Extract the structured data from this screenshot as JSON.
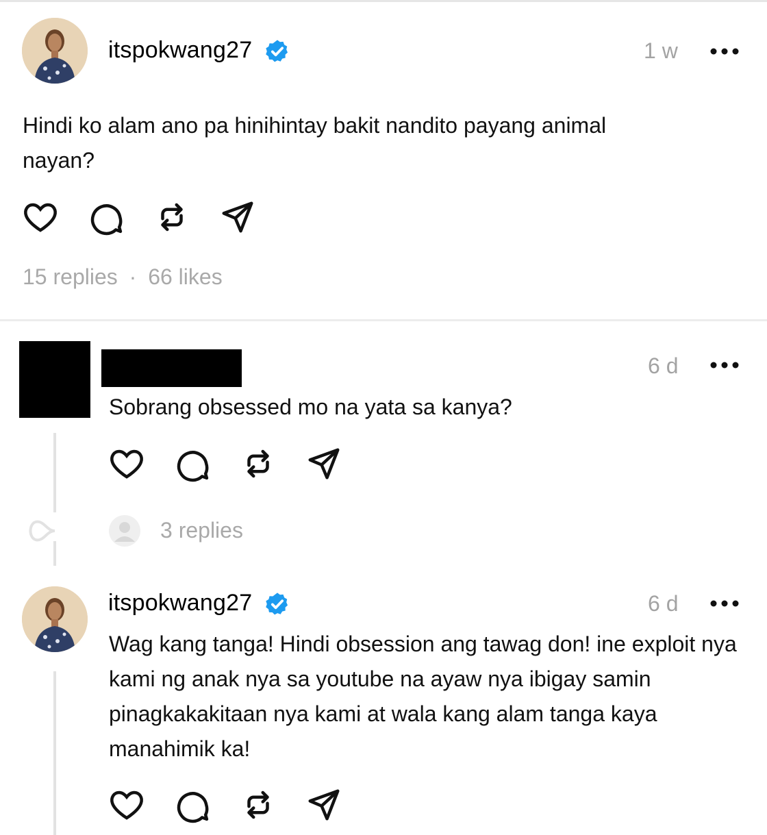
{
  "post": {
    "username": "itspokwang27",
    "time": "1 w",
    "text": "Hindi ko alam ano pa hinihintay bakit nandito payang animal nayan?",
    "replies": "15 replies",
    "separator": "·",
    "likes": "66 likes"
  },
  "reply1": {
    "time": "6 d",
    "text": "Sobrang obsessed mo na yata sa kanya?",
    "replies_count": "3 replies"
  },
  "reply2": {
    "username": "itspokwang27",
    "time": "6 d",
    "text": "Wag kang tanga! Hindi obsession ang tawag don! ine exploit nya kami ng anak nya sa youtube na ayaw nya ibigay samin pinagkakakitaan nya kami at wala kang alam tanga kaya manahimik ka!"
  },
  "icons": {
    "actions": [
      "heart-icon",
      "comment-icon",
      "repost-icon",
      "share-icon"
    ],
    "verified": "verified-badge-icon",
    "more": "more-options-icon"
  },
  "colors": {
    "verified": "#1d9bf0",
    "muted": "#a3a3a3",
    "text": "#111111"
  }
}
